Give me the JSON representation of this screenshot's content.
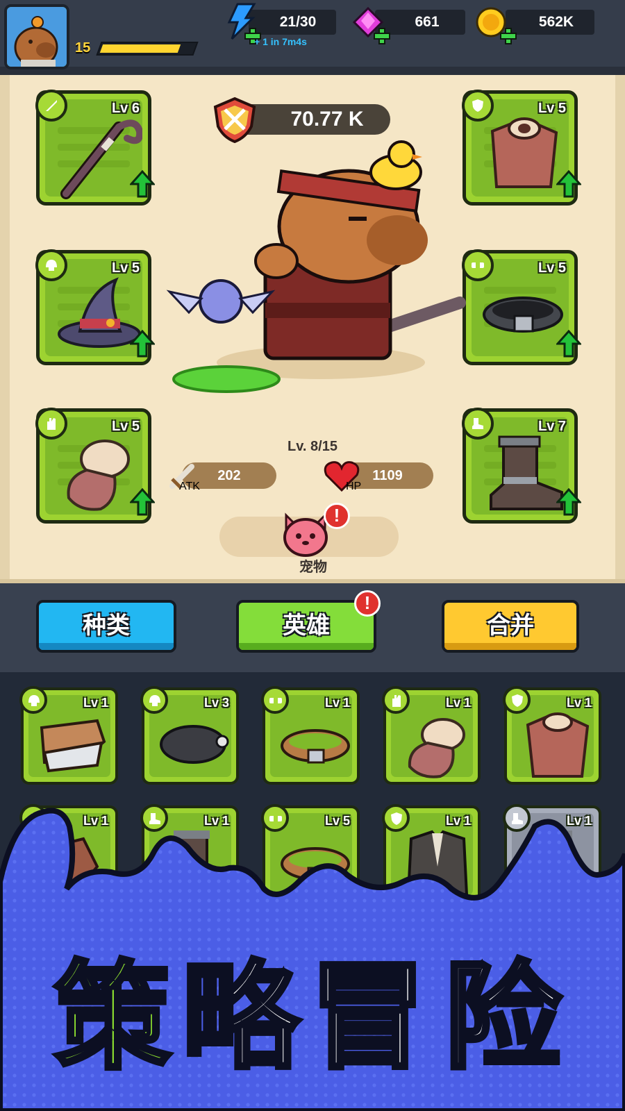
{
  "player": {
    "level": "15",
    "xp_fraction": 0.85
  },
  "resources": {
    "energy": {
      "value": "21/30",
      "regen": "+ 1 in 7m4s"
    },
    "gems": {
      "value": "661"
    },
    "gold": {
      "value": "562K"
    }
  },
  "hero": {
    "power": "70.77 K",
    "level": "Lv. 8/15",
    "atk_label": "ATK",
    "atk": "202",
    "hp_label": "HP",
    "hp": "1109",
    "pet_label": "宠物"
  },
  "equipment": {
    "weapon": {
      "level": "Lv 6",
      "icon": "staff-icon",
      "slot_icon": "sword-icon"
    },
    "helmet": {
      "level": "Lv 5",
      "icon": "wizard-hat-icon",
      "slot_icon": "helmet-icon"
    },
    "gloves": {
      "level": "Lv 5",
      "icon": "fur-glove-icon",
      "slot_icon": "glove-icon"
    },
    "armor": {
      "level": "Lv 5",
      "icon": "leather-armor-icon",
      "slot_icon": "shield-icon"
    },
    "belt": {
      "level": "Lv 5",
      "icon": "spiked-belt-icon",
      "slot_icon": "belt-icon"
    },
    "boots": {
      "level": "Lv 7",
      "icon": "boot-icon",
      "slot_icon": "boot-slot-icon"
    }
  },
  "tabs": {
    "category": "种类",
    "hero": "英雄",
    "merge": "合并"
  },
  "inventory": [
    {
      "level": "Lv 1",
      "icon": "fang-helmet-icon",
      "slot_icon": "helmet-icon",
      "rarity": "green"
    },
    {
      "level": "Lv 3",
      "icon": "pirate-hat-icon",
      "slot_icon": "helmet-icon",
      "rarity": "green"
    },
    {
      "level": "Lv 1",
      "icon": "leather-belt-icon",
      "slot_icon": "belt-icon",
      "rarity": "green"
    },
    {
      "level": "Lv 1",
      "icon": "fur-glove-icon",
      "slot_icon": "glove-icon",
      "rarity": "green"
    },
    {
      "level": "Lv 1",
      "icon": "leather-armor-icon",
      "slot_icon": "shield-icon",
      "rarity": "green"
    },
    {
      "level": "Lv 1",
      "icon": "glove-icon",
      "slot_icon": "glove-icon",
      "rarity": "green"
    },
    {
      "level": "Lv 1",
      "icon": "boot-icon",
      "slot_icon": "boot-slot-icon",
      "rarity": "green"
    },
    {
      "level": "Lv 5",
      "icon": "leather-belt-icon",
      "slot_icon": "belt-icon",
      "rarity": "green"
    },
    {
      "level": "Lv 1",
      "icon": "coat-icon",
      "slot_icon": "shield-icon",
      "rarity": "green"
    },
    {
      "level": "Lv 1",
      "icon": "boot-icon",
      "slot_icon": "boot-slot-icon",
      "rarity": "gray"
    }
  ],
  "banner": {
    "chars": [
      "策",
      "略",
      "冒",
      "险"
    ]
  },
  "colors": {
    "green_slot": "#9dd331",
    "banner_blue": "#4b5ee6",
    "banner_green": "#8de030",
    "gold": "#ffd530"
  }
}
